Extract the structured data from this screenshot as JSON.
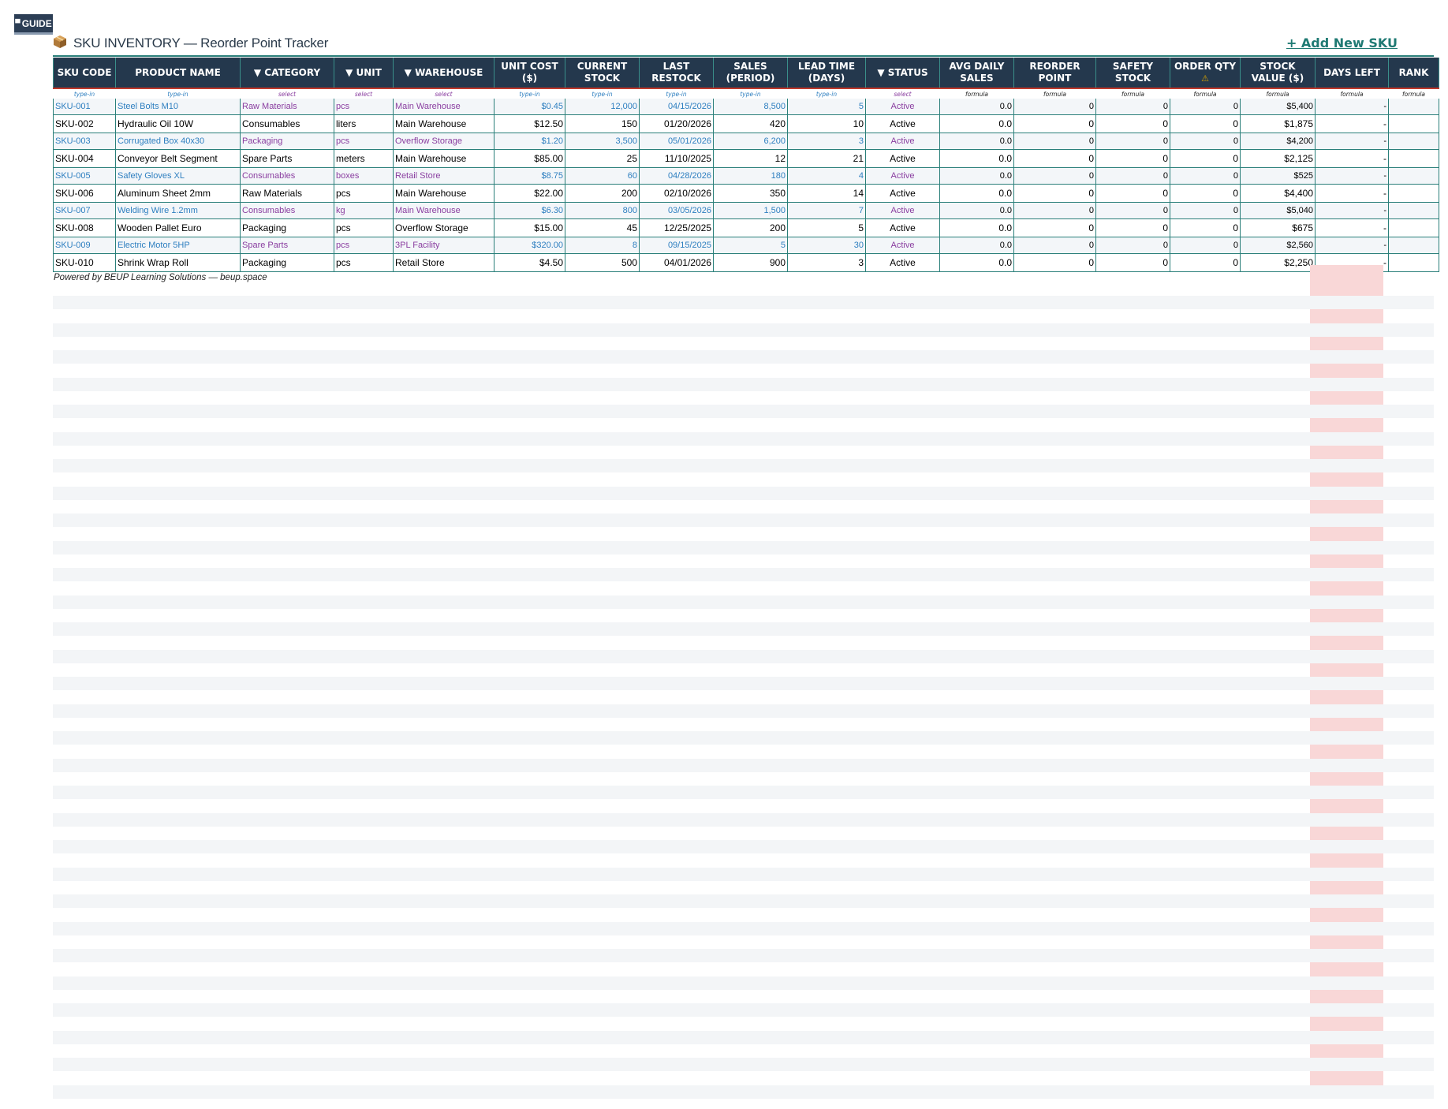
{
  "guide": {
    "label": "GUIDE",
    "icon": "table-icon"
  },
  "header": {
    "icon": "package-box-icon",
    "title": "SKU INVENTORY — Reorder Point Tracker",
    "add_link": "+ Add New SKU"
  },
  "hints": [
    "type-in",
    "type-in",
    "select",
    "select",
    "select",
    "type-in",
    "type-in",
    "type-in",
    "type-in",
    "type-in",
    "select",
    "formula",
    "formula",
    "formula",
    "formula",
    "formula",
    "formula",
    "formula"
  ],
  "columns": [
    "SKU CODE",
    "PRODUCT NAME",
    "▼ CATEGORY",
    "▼ UNIT",
    "▼ WAREHOUSE",
    "UNIT COST ($)",
    "CURRENT STOCK",
    "LAST RESTOCK",
    "SALES (PERIOD)",
    "LEAD TIME (DAYS)",
    "▼ STATUS",
    "AVG DAILY SALES",
    "REORDER POINT",
    "SAFETY STOCK",
    "ORDER QTY",
    "STOCK VALUE ($)",
    "DAYS LEFT",
    "RANK"
  ],
  "order_qty_warning_icon": "warning-icon",
  "rows": [
    [
      "SKU-001",
      "Steel Bolts M10",
      "Raw Materials",
      "pcs",
      "Main Warehouse",
      "$0.45",
      "12,000",
      "04/15/2026",
      "8,500",
      "5",
      "Active",
      "0.0",
      "0",
      "0",
      "0",
      "$5,400",
      "-",
      ""
    ],
    [
      "SKU-002",
      "Hydraulic Oil 10W",
      "Consumables",
      "liters",
      "Main Warehouse",
      "$12.50",
      "150",
      "01/20/2026",
      "420",
      "10",
      "Active",
      "0.0",
      "0",
      "0",
      "0",
      "$1,875",
      "-",
      ""
    ],
    [
      "SKU-003",
      "Corrugated Box 40x30",
      "Packaging",
      "pcs",
      "Overflow Storage",
      "$1.20",
      "3,500",
      "05/01/2026",
      "6,200",
      "3",
      "Active",
      "0.0",
      "0",
      "0",
      "0",
      "$4,200",
      "-",
      ""
    ],
    [
      "SKU-004",
      "Conveyor Belt Segment",
      "Spare Parts",
      "meters",
      "Main Warehouse",
      "$85.00",
      "25",
      "11/10/2025",
      "12",
      "21",
      "Active",
      "0.0",
      "0",
      "0",
      "0",
      "$2,125",
      "-",
      ""
    ],
    [
      "SKU-005",
      "Safety Gloves XL",
      "Consumables",
      "boxes",
      "Retail Store",
      "$8.75",
      "60",
      "04/28/2026",
      "180",
      "4",
      "Active",
      "0.0",
      "0",
      "0",
      "0",
      "$525",
      "-",
      ""
    ],
    [
      "SKU-006",
      "Aluminum Sheet 2mm",
      "Raw Materials",
      "pcs",
      "Main Warehouse",
      "$22.00",
      "200",
      "02/10/2026",
      "350",
      "14",
      "Active",
      "0.0",
      "0",
      "0",
      "0",
      "$4,400",
      "-",
      ""
    ],
    [
      "SKU-007",
      "Welding Wire 1.2mm",
      "Consumables",
      "kg",
      "Main Warehouse",
      "$6.30",
      "800",
      "03/05/2026",
      "1,500",
      "7",
      "Active",
      "0.0",
      "0",
      "0",
      "0",
      "$5,040",
      "-",
      ""
    ],
    [
      "SKU-008",
      "Wooden Pallet Euro",
      "Packaging",
      "pcs",
      "Overflow Storage",
      "$15.00",
      "45",
      "12/25/2025",
      "200",
      "5",
      "Active",
      "0.0",
      "0",
      "0",
      "0",
      "$675",
      "-",
      ""
    ],
    [
      "SKU-009",
      "Electric Motor 5HP",
      "Spare Parts",
      "pcs",
      "3PL Facility",
      "$320.00",
      "8",
      "09/15/2025",
      "5",
      "30",
      "Active",
      "0.0",
      "0",
      "0",
      "0",
      "$2,560",
      "-",
      ""
    ],
    [
      "SKU-010",
      "Shrink Wrap Roll",
      "Packaging",
      "pcs",
      "Retail Store",
      "$4.50",
      "500",
      "04/01/2026",
      "900",
      "3",
      "Active",
      "0.0",
      "0",
      "0",
      "0",
      "$2,250",
      "-",
      ""
    ]
  ],
  "footer": "Powered by BEUP Learning Solutions — beup.space",
  "colors": {
    "header_bg": "#24384d",
    "accent_teal": "#2a7f7a",
    "typein_blue": "#2e7fc0",
    "select_purple": "#8a3ea0",
    "highlight_pink": "#f9d7d7"
  }
}
